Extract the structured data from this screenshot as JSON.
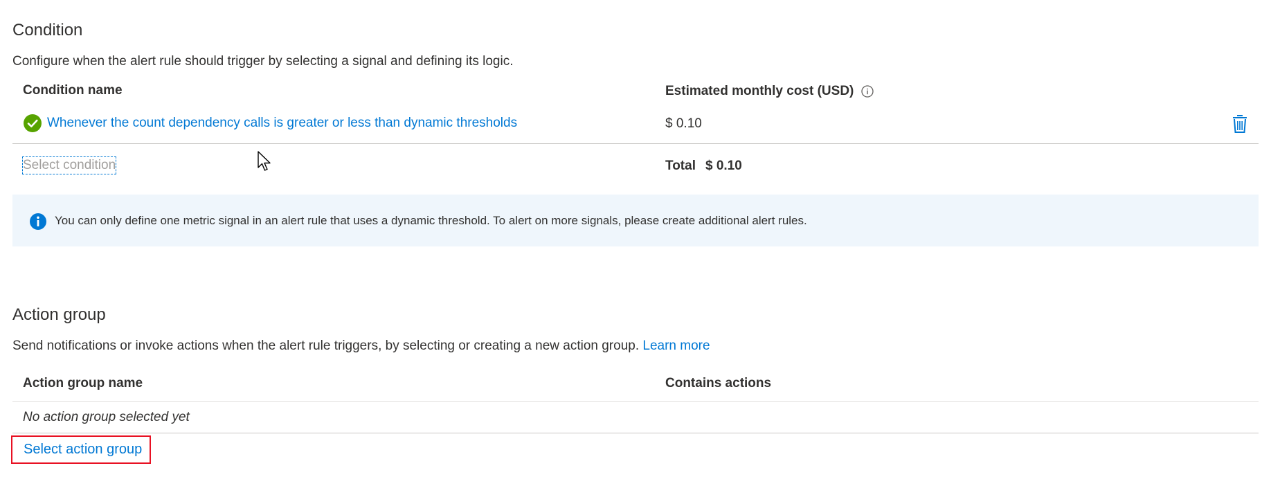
{
  "condition": {
    "title": "Condition",
    "description": "Configure when the alert rule should trigger by selecting a signal and defining its logic.",
    "col_name": "Condition name",
    "col_cost": "Estimated monthly cost (USD)",
    "rows": [
      {
        "name": "Whenever the count dependency calls is greater or less than dynamic thresholds",
        "cost": "$ 0.10",
        "status_icon": "check-circle-icon"
      }
    ],
    "select_label": "Select condition",
    "total_label": "Total",
    "total_value": "$ 0.10",
    "info_text": "You can only define one metric signal in an alert rule that uses a dynamic threshold. To alert on more signals, please create additional alert rules."
  },
  "action_group": {
    "title": "Action group",
    "description": "Send notifications or invoke actions when the alert rule triggers, by selecting or creating a new action group.",
    "learn_more": "Learn more",
    "col_name": "Action group name",
    "col_actions": "Contains actions",
    "empty_text": "No action group selected yet",
    "select_label": "Select action group"
  },
  "colors": {
    "accent": "#0078d4",
    "success": "#57a300",
    "highlight_border": "#e81123",
    "info_bg": "#eff6fc"
  }
}
